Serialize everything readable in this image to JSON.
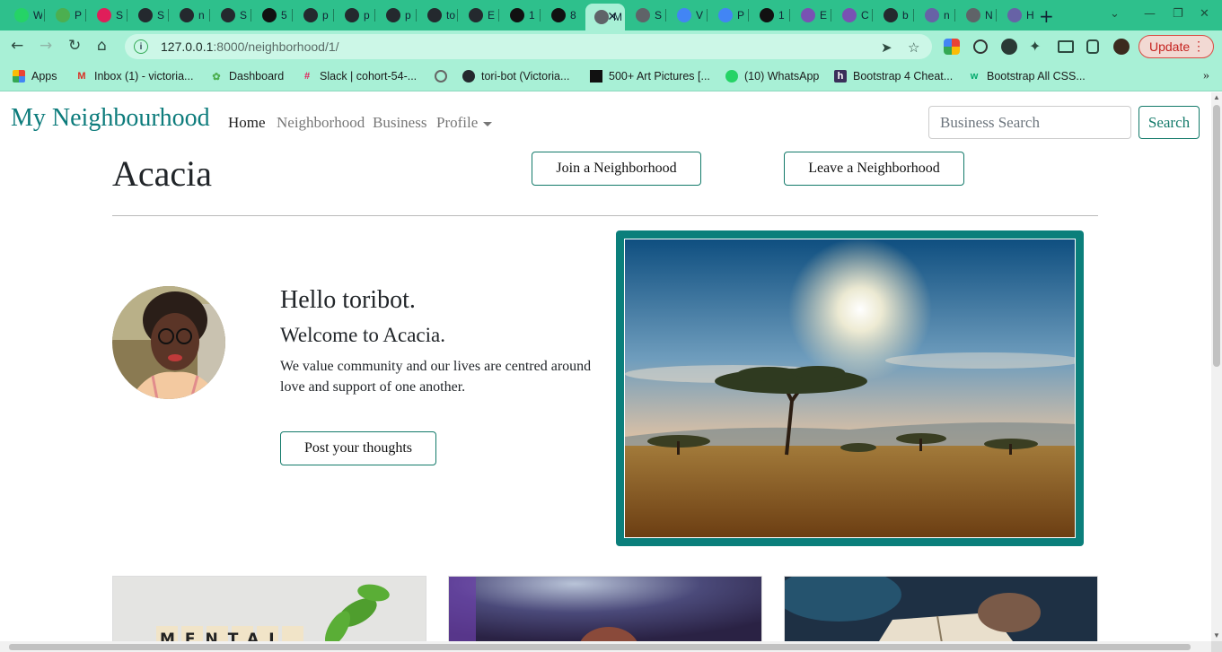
{
  "browser": {
    "tabs": [
      {
        "label": "W",
        "icon": "whatsapp-icon",
        "color": "#25d366"
      },
      {
        "label": "P",
        "icon": "palm-icon",
        "color": "#4caf50"
      },
      {
        "label": "S",
        "icon": "slack-icon",
        "color": "#e01e5a"
      },
      {
        "label": "S",
        "icon": "github-icon",
        "color": "#24292e"
      },
      {
        "label": "n",
        "icon": "github-icon",
        "color": "#24292e"
      },
      {
        "label": "S",
        "icon": "github-icon",
        "color": "#24292e"
      },
      {
        "label": "5",
        "icon": "pictures-icon",
        "color": "#111111"
      },
      {
        "label": "p",
        "icon": "github-icon",
        "color": "#24292e"
      },
      {
        "label": "p",
        "icon": "github-icon",
        "color": "#24292e"
      },
      {
        "label": "p",
        "icon": "github-icon",
        "color": "#24292e"
      },
      {
        "label": "to",
        "icon": "github-icon",
        "color": "#24292e"
      },
      {
        "label": "E",
        "icon": "github-icon",
        "color": "#24292e"
      },
      {
        "label": "1",
        "icon": "istock-icon",
        "color": "#111111"
      },
      {
        "label": "8",
        "icon": "istock-icon",
        "color": "#111111"
      },
      {
        "label": "M",
        "icon": "globe-icon",
        "color": "#5f6368",
        "active": true
      },
      {
        "label": "S",
        "icon": "globe-icon",
        "color": "#5f6368"
      },
      {
        "label": "V",
        "icon": "google-icon",
        "color": "#4285f4"
      },
      {
        "label": "P",
        "icon": "google-icon",
        "color": "#4285f4"
      },
      {
        "label": "1",
        "icon": "pictures-icon",
        "color": "#111111"
      },
      {
        "label": "E",
        "icon": "bootstrap-icon",
        "color": "#7952b3"
      },
      {
        "label": "C",
        "icon": "bootstrap-icon",
        "color": "#7952b3"
      },
      {
        "label": "b",
        "icon": "github-icon",
        "color": "#24292e"
      },
      {
        "label": "n",
        "icon": "heroku-icon",
        "color": "#6762a6"
      },
      {
        "label": "N",
        "icon": "globe-icon",
        "color": "#5f6368"
      },
      {
        "label": "H",
        "icon": "heroku-icon",
        "color": "#6762a6"
      }
    ],
    "url_host": "127.0.0.1",
    "url_path": ":8000/neighborhood/1/",
    "update_label": "Update",
    "bookmarks": [
      {
        "label": "Apps",
        "icon": "apps-grid-icon"
      },
      {
        "label": "Inbox (1) - victoria...",
        "icon": "gmail-icon"
      },
      {
        "label": "Dashboard",
        "icon": "palm-icon"
      },
      {
        "label": "Slack | cohort-54-...",
        "icon": "slack-icon"
      },
      {
        "label": "",
        "icon": "globe-icon"
      },
      {
        "label": "tori-bot (Victoria...",
        "icon": "github-icon"
      },
      {
        "label": "500+ Art Pictures [...",
        "icon": "pictures-icon"
      },
      {
        "label": "(10) WhatsApp",
        "icon": "whatsapp-icon"
      },
      {
        "label": "Bootstrap 4 Cheat...",
        "icon": "hackerthemes-icon"
      },
      {
        "label": "Bootstrap All CSS...",
        "icon": "w3-icon"
      }
    ]
  },
  "site": {
    "brand": "My Neighbourhood",
    "nav": {
      "home": "Home",
      "neighborhood": "Neighborhood",
      "business": "Business",
      "profile": "Profile"
    },
    "search": {
      "placeholder": "Business Search",
      "button": "Search"
    },
    "neighborhood_name": "Acacia",
    "join_label": "Join a Neighborhood",
    "leave_label": "Leave a Neighborhood",
    "greeting": "Hello toribot.",
    "welcome": "Welcome to Acacia.",
    "description": "We value community and our lives are centred around love and support of one another.",
    "post_label": "Post your thoughts",
    "cards": [
      {
        "text": "MENTAL"
      },
      {
        "text": ""
      },
      {
        "text": ""
      }
    ]
  },
  "colors": {
    "accent": "#0d7c7c",
    "tabstrip": "#2ec08c",
    "toolbar": "#a8f0d6"
  }
}
